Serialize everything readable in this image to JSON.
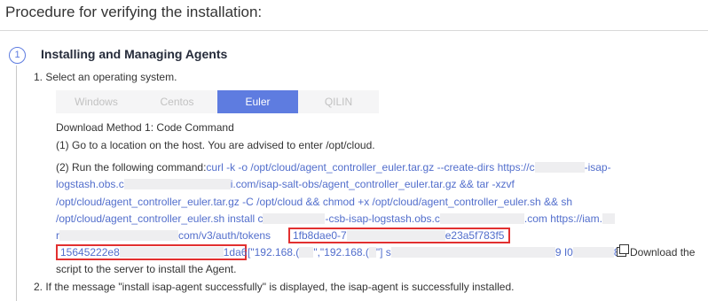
{
  "page_title": "Procedure for verifying the installation:",
  "step": {
    "number": "1",
    "title": "Installing and Managing Agents"
  },
  "select_os": "1. Select an operating system.",
  "tabs": [
    {
      "label": "Windows",
      "active": false
    },
    {
      "label": "Centos",
      "active": false
    },
    {
      "label": "Euler",
      "active": true
    },
    {
      "label": "QILIN",
      "active": false
    }
  ],
  "method_title": "Download Method 1: Code Command",
  "step_go": "(1) Go to a location on the host. You are advised to enter /opt/cloud.",
  "cmd": {
    "prefix": "(2) Run the following command:",
    "l1": "curl -k -o /opt/cloud/agent_controller_euler.tar.gz --create-dirs https://c",
    "l1_tail": "-isap-",
    "l2_a": "logstash.obs.c",
    "l2_b": "i.com/isap-salt-obs/agent_controller_euler.tar.gz && tar -xzvf",
    "l3": "/opt/cloud/agent_controller_euler.tar.gz -C /opt/cloud && chmod +x /opt/cloud/agent_controller_euler.sh && sh",
    "l4_a": "/opt/cloud/agent_controller_euler.sh install c",
    "l4_b": "-csb-isap-logstash.obs.c",
    "l4_c": ".com https://iam.",
    "l5_a": "r",
    "l5_b": "com/v3/auth/tokens",
    "token_start": "1fb8dae0-7",
    "token_end": "e23a5f783f5",
    "l6_a": "15645222e8",
    "l6_b": "1da6",
    "l6_c": "[\"192.168.(",
    "l6_d": "\",\"192.168.(",
    "l6_e": "\"] s",
    "l6_f": "9 I0",
    "l6_g": "8",
    "download_label": "Download the",
    "l7": "script to the server to install the Agent."
  },
  "final_step": "2. If the message \"install isap-agent successfully\" is displayed, the isap-agent is successfully installed."
}
